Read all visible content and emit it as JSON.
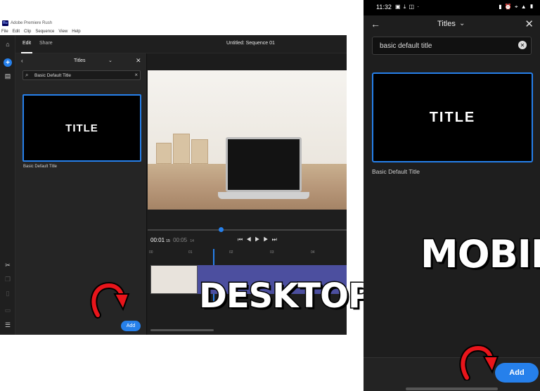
{
  "desktop": {
    "window_title": "Adobe Premiere Rush",
    "app_icon_text": "Ru",
    "menu": [
      "File",
      "Edit",
      "Clip",
      "Sequence",
      "View",
      "Help"
    ],
    "tabs": {
      "edit": "Edit",
      "share": "Share"
    },
    "sequence_title": "Untitled: Sequence 01",
    "panel": {
      "title": "Titles",
      "search_value": "Basic Default Title",
      "thumb_text": "TITLE",
      "thumb_label": "Basic Default Title",
      "add_label": "Add"
    },
    "timecode": {
      "current": "00:01",
      "current_frames": "15",
      "duration": "00:05",
      "duration_frames": "14"
    },
    "ruler_ticks": [
      "00",
      "01",
      "02",
      "03",
      "04"
    ],
    "accent_color": "#2680eb"
  },
  "mobile": {
    "status_time": "11:32",
    "header_title": "Titles",
    "search_value": "basic default title",
    "thumb_text": "TITLE",
    "thumb_label": "Basic Default Title",
    "add_label": "Add"
  },
  "overlays": {
    "desktop_word": "DESKTOP",
    "mobile_word": "MOBILE"
  }
}
